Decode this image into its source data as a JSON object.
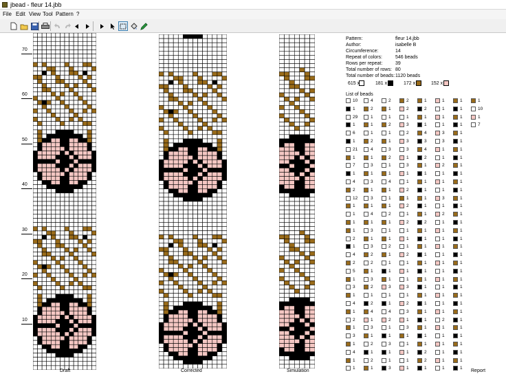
{
  "window": {
    "title": "jbead - fleur 14.jbb"
  },
  "menu": [
    "File",
    "Edit",
    "View",
    "Tool",
    "Pattern",
    "?"
  ],
  "toolbar": {
    "buttons": [
      "new-icon",
      "open-icon",
      "save-icon",
      "print-icon",
      "undo-icon",
      "redo-icon",
      "arrow-left-icon",
      "arrow-right-icon",
      "select-arrow-icon",
      "select-rect-icon",
      "fill-icon",
      "pencil-icon"
    ],
    "palette_row1": [
      "#000000",
      "#d20000",
      "#ef5b1f",
      "#ffde00",
      "#8cc63f",
      "#1aa548",
      "#00a99d",
      "#0071bc",
      "#2e3192",
      "#662d91",
      "#9e005d",
      "#c7b299",
      "#a67c52",
      "#603813"
    ],
    "palette_row2": [
      "#ffffff",
      "#f4f4f4",
      "#cccccc",
      "#999999",
      "#666666",
      "#333333",
      "#f7c9c9",
      "#f4a6c8",
      "#b3e0f2",
      "#c2e3b4",
      "#ffe8a3",
      "#e0c8a0",
      "#c49a6c",
      "#8c6239"
    ]
  },
  "colors": {
    "white": "#ffffff",
    "black": "#000000",
    "brown": "#996b1a",
    "pink": "#f4c7c3",
    "grid": "#000000"
  },
  "views": {
    "draft_label": "Draft",
    "corrected_label": "Corrected",
    "simulation_label": "Simulation",
    "report_label": "Report"
  },
  "ruler": [
    "70",
    "60",
    "50",
    "40",
    "30",
    "20",
    "10"
  ],
  "report": {
    "fields": [
      {
        "key": "Pattern:",
        "value": "fleur 14.jbb"
      },
      {
        "key": "Author:",
        "value": "isabelle B"
      },
      {
        "key": "Circumference:",
        "value": "14"
      },
      {
        "key": "Repeat of colors:",
        "value": "546 beads"
      },
      {
        "key": "Rows per repeat:",
        "value": "39"
      },
      {
        "key": "Total number of rows:",
        "value": "80"
      },
      {
        "key": "Total number of beads:",
        "value": "1120 beads"
      }
    ],
    "color_counts": [
      {
        "count": "615 x",
        "color": "white"
      },
      {
        "count": "181 x",
        "color": "black"
      },
      {
        "count": "172 x",
        "color": "brown"
      },
      {
        "count": "152 x",
        "color": "pink"
      }
    ],
    "list_title": "List of beads",
    "bead_list": [
      [
        [
          "white",
          "10"
        ],
        [
          "black",
          "1"
        ],
        [
          "white",
          "29"
        ],
        [
          "black",
          "1"
        ],
        [
          "white",
          "6"
        ],
        [
          "black",
          "1"
        ],
        [
          "white",
          "21"
        ],
        [
          "brown",
          "1"
        ],
        [
          "white",
          "7"
        ],
        [
          "black",
          "1"
        ],
        [
          "white",
          "4"
        ],
        [
          "brown",
          "2"
        ],
        [
          "white",
          "12"
        ],
        [
          "brown",
          "1"
        ],
        [
          "white",
          "1"
        ],
        [
          "brown",
          "1"
        ],
        [
          "brown",
          "1"
        ],
        [
          "white",
          "2"
        ],
        [
          "black",
          "1"
        ],
        [
          "white",
          "4"
        ],
        [
          "brown",
          "2"
        ],
        [
          "white",
          "5"
        ],
        [
          "brown",
          "1"
        ],
        [
          "white",
          "3"
        ],
        [
          "brown",
          "1"
        ],
        [
          "white",
          "4"
        ],
        [
          "brown",
          "1"
        ],
        [
          "white",
          "2"
        ],
        [
          "brown",
          "1"
        ],
        [
          "white",
          "3"
        ],
        [
          "brown",
          "1"
        ],
        [
          "white",
          "4"
        ],
        [
          "brown",
          "1"
        ],
        [
          "white",
          "1"
        ]
      ],
      [
        [
          "white",
          "4"
        ],
        [
          "brown",
          "2"
        ],
        [
          "white",
          "1"
        ],
        [
          "brown",
          "1"
        ],
        [
          "white",
          "1"
        ],
        [
          "brown",
          "2"
        ],
        [
          "white",
          "4"
        ],
        [
          "brown",
          "1"
        ],
        [
          "white",
          "3"
        ],
        [
          "brown",
          "1"
        ],
        [
          "white",
          "3"
        ],
        [
          "brown",
          "1"
        ],
        [
          "white",
          "3"
        ],
        [
          "brown",
          "1"
        ],
        [
          "white",
          "4"
        ],
        [
          "brown",
          "1"
        ],
        [
          "white",
          "3"
        ],
        [
          "brown",
          "1"
        ],
        [
          "white",
          "3"
        ],
        [
          "brown",
          "2"
        ],
        [
          "white",
          "2"
        ],
        [
          "brown",
          "1"
        ],
        [
          "white",
          "3"
        ],
        [
          "brown",
          "2"
        ],
        [
          "white",
          "1"
        ],
        [
          "black",
          "2"
        ],
        [
          "brown",
          "4"
        ],
        [
          "pink",
          "1"
        ],
        [
          "white",
          "3"
        ],
        [
          "brown",
          "1"
        ],
        [
          "white",
          "2"
        ],
        [
          "black",
          "1"
        ],
        [
          "white",
          "2"
        ],
        [
          "brown",
          "1"
        ]
      ],
      [
        [
          "white",
          "2"
        ],
        [
          "brown",
          "1"
        ],
        [
          "white",
          "1"
        ],
        [
          "brown",
          "2"
        ],
        [
          "white",
          "1"
        ],
        [
          "brown",
          "1"
        ],
        [
          "white",
          "3"
        ],
        [
          "brown",
          "2"
        ],
        [
          "white",
          "1"
        ],
        [
          "brown",
          "1"
        ],
        [
          "white",
          "4"
        ],
        [
          "brown",
          "1"
        ],
        [
          "white",
          "1"
        ],
        [
          "brown",
          "1"
        ],
        [
          "white",
          "2"
        ],
        [
          "brown",
          "1"
        ],
        [
          "white",
          "1"
        ],
        [
          "brown",
          "1"
        ],
        [
          "white",
          "2"
        ],
        [
          "brown",
          "1"
        ],
        [
          "white",
          "1"
        ],
        [
          "black",
          "1"
        ],
        [
          "brown",
          "1"
        ],
        [
          "pink",
          "3"
        ],
        [
          "white",
          "1"
        ],
        [
          "black",
          "1"
        ],
        [
          "white",
          "4"
        ],
        [
          "pink",
          "2"
        ],
        [
          "white",
          "1"
        ],
        [
          "black",
          "1"
        ],
        [
          "white",
          "3"
        ],
        [
          "black",
          "1"
        ],
        [
          "white",
          "1"
        ],
        [
          "black",
          "3"
        ]
      ],
      [
        [
          "brown",
          "2"
        ],
        [
          "pink",
          "2"
        ],
        [
          "white",
          "1"
        ],
        [
          "pink",
          "3"
        ],
        [
          "white",
          "2"
        ],
        [
          "pink",
          "3"
        ],
        [
          "white",
          "3"
        ],
        [
          "pink",
          "1"
        ],
        [
          "white",
          "3"
        ],
        [
          "pink",
          "1"
        ],
        [
          "white",
          "1"
        ],
        [
          "pink",
          "2"
        ],
        [
          "brown",
          "1"
        ],
        [
          "pink",
          "2"
        ],
        [
          "white",
          "1"
        ],
        [
          "pink",
          "2"
        ],
        [
          "white",
          "1"
        ],
        [
          "pink",
          "1"
        ],
        [
          "white",
          "1"
        ],
        [
          "pink",
          "2"
        ],
        [
          "white",
          "1"
        ],
        [
          "pink",
          "1"
        ],
        [
          "white",
          "1"
        ],
        [
          "pink",
          "3"
        ],
        [
          "white",
          "1"
        ],
        [
          "pink",
          "2"
        ],
        [
          "white",
          "3"
        ],
        [
          "pink",
          "1"
        ],
        [
          "white",
          "3"
        ],
        [
          "brown",
          "1"
        ],
        [
          "white",
          "1"
        ],
        [
          "pink",
          "1"
        ],
        [
          "white",
          "1"
        ],
        [
          "pink",
          "1"
        ]
      ],
      [
        [
          "brown",
          "1"
        ],
        [
          "black",
          "2"
        ],
        [
          "brown",
          "1"
        ],
        [
          "black",
          "1"
        ],
        [
          "brown",
          "4"
        ],
        [
          "black",
          "3"
        ],
        [
          "brown",
          "4"
        ],
        [
          "black",
          "2"
        ],
        [
          "brown",
          "1"
        ],
        [
          "black",
          "1"
        ],
        [
          "brown",
          "1"
        ],
        [
          "black",
          "1"
        ],
        [
          "brown",
          "1"
        ],
        [
          "black",
          "1"
        ],
        [
          "brown",
          "1"
        ],
        [
          "black",
          "2"
        ],
        [
          "brown",
          "1"
        ],
        [
          "black",
          "1"
        ],
        [
          "brown",
          "1"
        ],
        [
          "black",
          "1"
        ],
        [
          "brown",
          "1"
        ],
        [
          "black",
          "1"
        ],
        [
          "brown",
          "1"
        ],
        [
          "black",
          "1"
        ],
        [
          "brown",
          "1"
        ],
        [
          "black",
          "1"
        ],
        [
          "brown",
          "1"
        ],
        [
          "black",
          "1"
        ],
        [
          "brown",
          "1"
        ],
        [
          "black",
          "1"
        ],
        [
          "brown",
          "1"
        ],
        [
          "black",
          "2"
        ],
        [
          "brown",
          "2"
        ],
        [
          "black",
          "1"
        ]
      ],
      [
        [
          "pink",
          "1"
        ],
        [
          "white",
          "1"
        ],
        [
          "pink",
          "1"
        ],
        [
          "white",
          "1"
        ],
        [
          "pink",
          "3"
        ],
        [
          "white",
          "3"
        ],
        [
          "pink",
          "1"
        ],
        [
          "white",
          "1"
        ],
        [
          "pink",
          "2"
        ],
        [
          "white",
          "1"
        ],
        [
          "pink",
          "1"
        ],
        [
          "white",
          "1"
        ],
        [
          "pink",
          "3"
        ],
        [
          "white",
          "1"
        ],
        [
          "pink",
          "2"
        ],
        [
          "white",
          "1"
        ],
        [
          "pink",
          "1"
        ],
        [
          "white",
          "1"
        ],
        [
          "pink",
          "1"
        ],
        [
          "white",
          "1"
        ],
        [
          "pink",
          "1"
        ],
        [
          "white",
          "1"
        ],
        [
          "pink",
          "1"
        ],
        [
          "white",
          "1"
        ],
        [
          "pink",
          "1"
        ],
        [
          "white",
          "1"
        ],
        [
          "pink",
          "1"
        ],
        [
          "white",
          "2"
        ],
        [
          "pink",
          "1"
        ],
        [
          "white",
          "1"
        ],
        [
          "pink",
          "1"
        ],
        [
          "white",
          "1"
        ],
        [
          "pink",
          "1"
        ],
        [
          "white",
          "1"
        ]
      ],
      [
        [
          "brown",
          "1"
        ],
        [
          "black",
          "1"
        ],
        [
          "brown",
          "1"
        ],
        [
          "black",
          "1"
        ],
        [
          "brown",
          "1"
        ],
        [
          "black",
          "1"
        ],
        [
          "brown",
          "1"
        ],
        [
          "black",
          "1"
        ],
        [
          "brown",
          "1"
        ],
        [
          "black",
          "1"
        ],
        [
          "brown",
          "1"
        ],
        [
          "black",
          "1"
        ],
        [
          "brown",
          "1"
        ],
        [
          "black",
          "1"
        ],
        [
          "brown",
          "1"
        ],
        [
          "black",
          "1"
        ],
        [
          "brown",
          "1"
        ],
        [
          "black",
          "1"
        ],
        [
          "brown",
          "1"
        ],
        [
          "black",
          "1"
        ],
        [
          "brown",
          "1"
        ],
        [
          "black",
          "1"
        ],
        [
          "brown",
          "1"
        ],
        [
          "black",
          "1"
        ],
        [
          "brown",
          "1"
        ],
        [
          "black",
          "1"
        ],
        [
          "brown",
          "1"
        ],
        [
          "black",
          "1"
        ],
        [
          "brown",
          "1"
        ],
        [
          "black",
          "1"
        ],
        [
          "brown",
          "1"
        ],
        [
          "black",
          "1"
        ],
        [
          "brown",
          "1"
        ],
        [
          "black",
          "1"
        ]
      ],
      [
        [
          "brown",
          "1"
        ],
        [
          "white",
          "10"
        ],
        [
          "pink",
          "1"
        ],
        [
          "white",
          "7"
        ]
      ]
    ]
  }
}
